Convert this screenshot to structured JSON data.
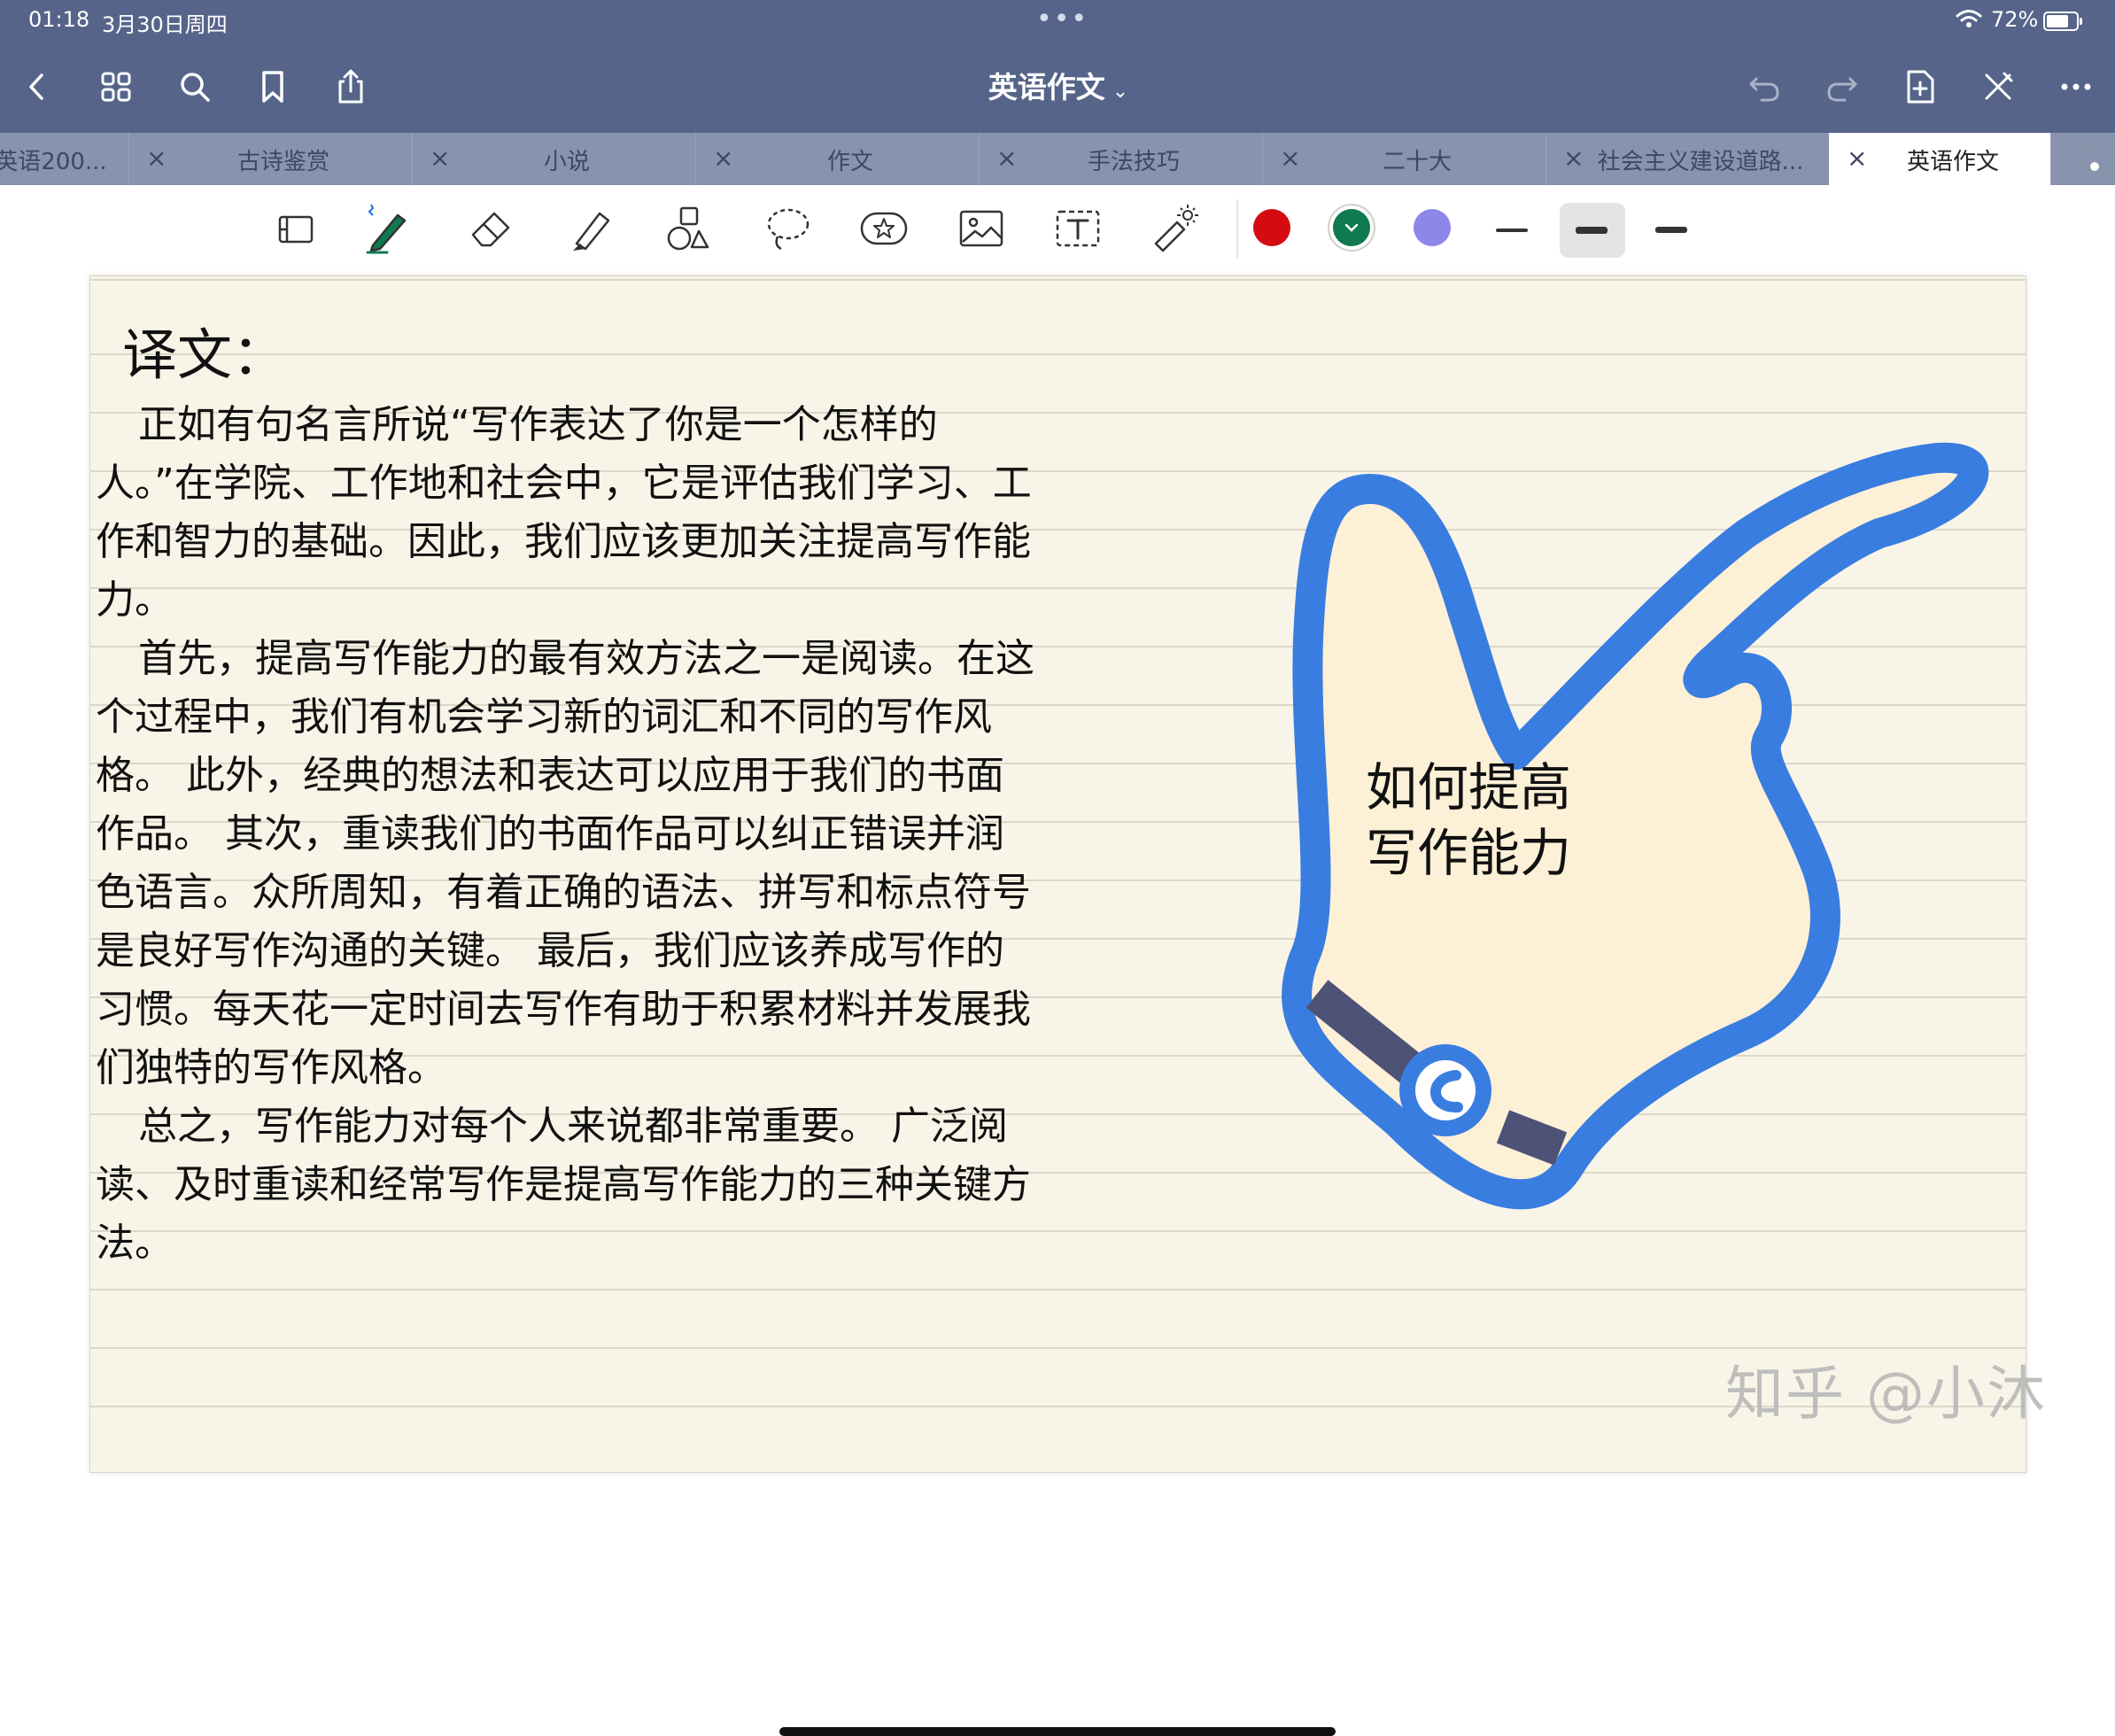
{
  "status_bar": {
    "time": "01:18",
    "date": "3月30日周四",
    "battery": "72%"
  },
  "nav": {
    "title": "英语作文",
    "title_chevron": "⌄"
  },
  "tabs": [
    {
      "label": "英语200...",
      "active": false
    },
    {
      "label": "古诗鉴赏",
      "active": false
    },
    {
      "label": "小说",
      "active": false
    },
    {
      "label": "作文",
      "active": false
    },
    {
      "label": "手法技巧",
      "active": false
    },
    {
      "label": "二十大",
      "active": false
    },
    {
      "label": "社会主义建设道路...",
      "active": false
    },
    {
      "label": "英语作文",
      "active": true
    }
  ],
  "tab_close_glyph": "×",
  "toolbar": {
    "tools": [
      "page-layout-icon",
      "pen-icon",
      "eraser-icon",
      "highlighter-icon",
      "shapes-icon",
      "lasso-icon",
      "sticker-icon",
      "image-icon",
      "text-box-icon",
      "laser-pointer-icon"
    ],
    "colors": [
      "#d40c12",
      "#0f7a4f",
      "#8c87e8"
    ],
    "selected_color": "#0f7a4f",
    "selected_stroke": 2
  },
  "page": {
    "heading": "译文：",
    "paragraphs": [
      "正如有句名言所说“写作表达了你是一个怎样的人。”在学院、工作地和社会中，它是评估我们学习、工作和智力的基础。因此，我们应该更加关注提高写作能力。",
      "首先，提高写作能力的最有效方法之一是阅读。在这个过程中，我们有机会学习新的词汇和不同的写作风格。 此外，经典的想法和表达可以应用于我们的书面作品。 其次，重读我们的书面作品可以纠正错误并润色语言。众所周知，有着正确的语法、拼写和标点符号是良好写作沟通的关键。 最后，我们应该养成写作的习惯。每天花一定时间去写作有助于积累材料并发展我们独特的写作风格。",
      "总之，写作能力对每个人来说都非常重要。 广泛阅读、及时重读和经常写作是提高写作能力的三种关键方法。"
    ],
    "bubble_line1": "如何提高",
    "bubble_line2": "写作能力",
    "watermark": "知乎 @小沐"
  }
}
